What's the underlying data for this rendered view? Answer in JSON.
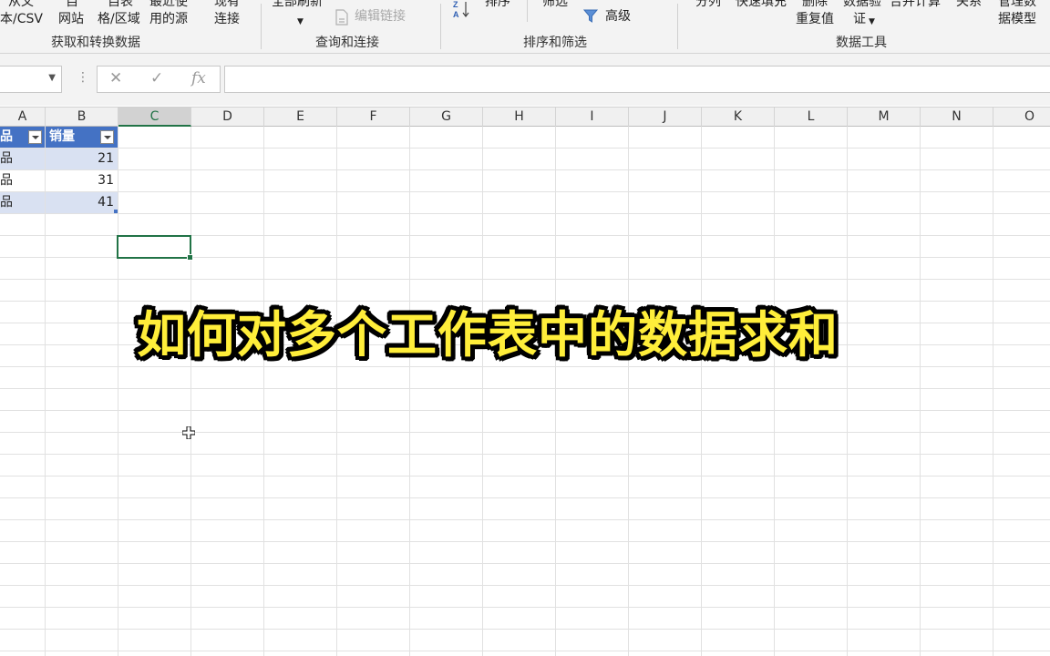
{
  "ribbon": {
    "get_transform": {
      "btn_text_csv": [
        "从文",
        "本/CSV"
      ],
      "btn_web": [
        "自",
        "网站"
      ],
      "btn_table_range": [
        "自表",
        "格/区域"
      ],
      "btn_recent_sources": [
        "最近使",
        "用的源"
      ],
      "btn_existing_conn": [
        "现有",
        "连接"
      ],
      "title": "获取和转换数据"
    },
    "queries": {
      "refresh_all": "全部刷新",
      "edit_links": "编辑链接",
      "title": "查询和连接"
    },
    "sort_filter": {
      "sort": "排序",
      "filter": "筛选",
      "advanced": "高级",
      "title": "排序和筛选"
    },
    "data_tools": {
      "split": "分列",
      "flash_fill": "快速填充",
      "remove_duplicates": [
        "删除",
        "重复值"
      ],
      "data_validation": [
        "数据验",
        "证"
      ],
      "consolidate": "合并计算",
      "relationships": "关系",
      "manage_model": [
        "管理数",
        "据模型"
      ],
      "title": "数据工具"
    }
  },
  "formula_bar": {
    "name_box": "",
    "cancel_glyph": "✕",
    "enter_glyph": "✓",
    "fx_glyph": "fx",
    "formula": ""
  },
  "columns": [
    "A",
    "B",
    "C",
    "D",
    "E",
    "F",
    "G",
    "H",
    "I",
    "J",
    "K",
    "L",
    "M",
    "N",
    "O"
  ],
  "selected_column": "C",
  "table": {
    "headers": [
      "品",
      "销量"
    ],
    "rows": [
      {
        "a": "品",
        "b": "21"
      },
      {
        "a": "品",
        "b": "31"
      },
      {
        "a": "品",
        "b": "41"
      }
    ]
  },
  "overlay_title": "如何对多个工作表中的数据求和",
  "colors": {
    "accent_green": "#217346",
    "table_header": "#4472c4",
    "table_band": "#d9e1f2",
    "overlay_text": "#ffee3a"
  }
}
